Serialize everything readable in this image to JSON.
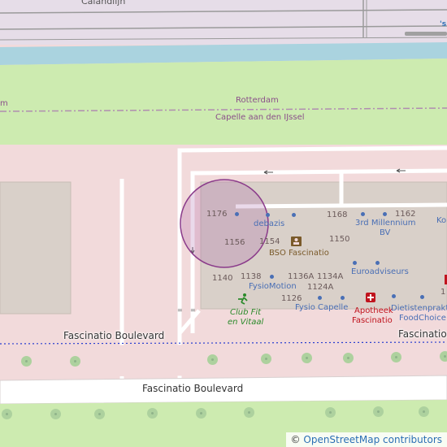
{
  "labels": {
    "street_top": "Calandlijn",
    "admin_a": "Rotterdam",
    "admin_b": "Capelle aan den IJssel",
    "road_upper_left": "Fascinatio Boulevard",
    "road_upper_right": "Fascinatio B",
    "road_main": "Fascinatio Boulevard",
    "edge_m": "m",
    "edge_s": "'s",
    "edge_ko": "Ko",
    "edge_1": "1"
  },
  "house_numbers": [
    "1176",
    "1168",
    "1162",
    "1156",
    "1154",
    "1150",
    "1140",
    "1138",
    "1136A",
    "1134A",
    "1124A",
    "1126"
  ],
  "pois": {
    "debazis": "debazis",
    "millennium_1": "3rd Millennium",
    "millennium_2": "BV",
    "bso": "BSO Fascinatio",
    "euroadviseurs": "Euroadviseurs",
    "fysiomotion": "FysioMotion",
    "fysio_capelle": "Fysio Capelle",
    "apotheek_1": "Apotheek",
    "apotheek_2": "Fascinatio",
    "dietist_1": "Dietistenprakti",
    "dietist_2": "FoodChoice",
    "club_1": "Club Fit",
    "club_2": "en Vitaal"
  },
  "attribution": {
    "symbol": "©",
    "text": "OpenStreetMap contributors"
  },
  "colors": {
    "residential": "#f2dadb",
    "grass": "#cdebb0",
    "water": "#aad3df",
    "building": "#d9d0c9",
    "road": "#ffffff",
    "admin_boundary": "#b08db0",
    "highlight_circle": "#8a3a8a"
  }
}
